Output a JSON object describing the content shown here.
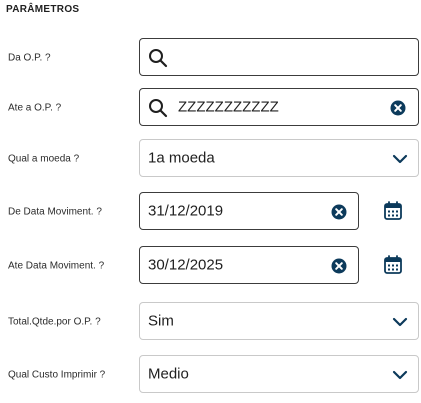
{
  "section": {
    "title": "PARÂMETROS"
  },
  "params": [
    {
      "label": "Da O.P. ?",
      "value": "",
      "type": "search"
    },
    {
      "label": "Ate a O.P. ?",
      "value": "ZZZZZZZZZZZ",
      "type": "search"
    },
    {
      "label": "Qual a moeda ?",
      "value": "1a moeda",
      "type": "select"
    },
    {
      "label": "De Data Moviment. ?",
      "value": "31/12/2019",
      "type": "date"
    },
    {
      "label": "Ate Data Moviment. ?",
      "value": "30/12/2025",
      "type": "date"
    },
    {
      "label": "Total.Qtde.por O.P. ?",
      "value": "Sim",
      "type": "select"
    },
    {
      "label": "Qual Custo Imprimir ?",
      "value": "Medio",
      "type": "select"
    }
  ],
  "icons": {
    "search": "search-icon",
    "clear": "clear-icon",
    "chevron": "chevron-down-icon",
    "calendar": "calendar-icon"
  },
  "colors": {
    "accent": "#0c3a5b",
    "border_active": "#3c3c3c",
    "border_select": "#c9c9c9"
  }
}
